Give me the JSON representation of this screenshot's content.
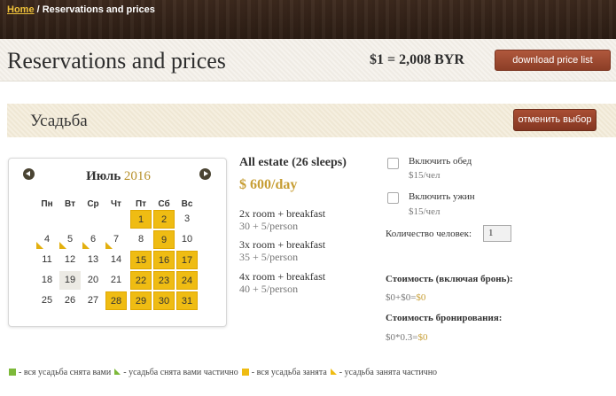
{
  "breadcrumb": {
    "home": "Home",
    "separator": " / ",
    "current": "Reservations and prices"
  },
  "header": {
    "title": "Reservations and prices",
    "rate": "$1 = 2,008 BYR",
    "download_label": "download price list"
  },
  "estate": {
    "name": "Усадьба",
    "cancel_label": "отменить выбор"
  },
  "calendar": {
    "month": "Июль",
    "year": "2016",
    "weekdays": [
      "Пн",
      "Вт",
      "Ср",
      "Чт",
      "Пт",
      "Сб",
      "Вс"
    ],
    "weeks": [
      [
        "",
        "",
        "",
        "",
        "1",
        "2",
        "3"
      ],
      [
        "4",
        "5",
        "6",
        "7",
        "8",
        "9",
        "10"
      ],
      [
        "11",
        "12",
        "13",
        "14",
        "15",
        "16",
        "17"
      ],
      [
        "18",
        "19",
        "20",
        "21",
        "22",
        "23",
        "24"
      ],
      [
        "25",
        "26",
        "27",
        "28",
        "29",
        "30",
        "31"
      ]
    ],
    "busy_days": [
      1,
      2,
      9,
      15,
      16,
      17,
      22,
      23,
      24,
      28,
      29,
      30,
      31
    ],
    "partial_days": [
      4,
      5,
      6,
      7
    ],
    "today": 19,
    "colors": {
      "busy": "#efbc13",
      "partial": "#e3b00f",
      "today": "#eceae4"
    }
  },
  "offer": {
    "title": "All estate (26 sleeps)",
    "price": "$ 600/day",
    "options": [
      {
        "title": "2x room + breakfast",
        "sub": "30 + 5/person"
      },
      {
        "title": "3x room + breakfast",
        "sub": "35 + 5/person"
      },
      {
        "title": "4x room + breakfast",
        "sub": "40 + 5/person"
      }
    ]
  },
  "extras": {
    "lunch_label": "Включить обед",
    "lunch_price": "$15/чел",
    "dinner_label": "Включить ужин",
    "dinner_price": "$15/чел",
    "people_label": "Количество человек:",
    "people_value": "1"
  },
  "cost": {
    "total_label": "Стоимость (включая бронь):",
    "total_formula": "$0+$0=",
    "total_result": "$0",
    "booking_label": "Стоимость бронирования:",
    "booking_formula": "$0*0.3=",
    "booking_result": "$0"
  },
  "legend": [
    {
      "shape": "square",
      "color": "green",
      "label": "- вся усадьба снята вами"
    },
    {
      "shape": "triangle",
      "color": "green",
      "label": "- усадьба снята вами частично"
    },
    {
      "shape": "square",
      "color": "yellow",
      "label": "- вся усадьба занята"
    },
    {
      "shape": "triangle",
      "color": "yellow",
      "label": "- усадьба занята частично"
    }
  ]
}
